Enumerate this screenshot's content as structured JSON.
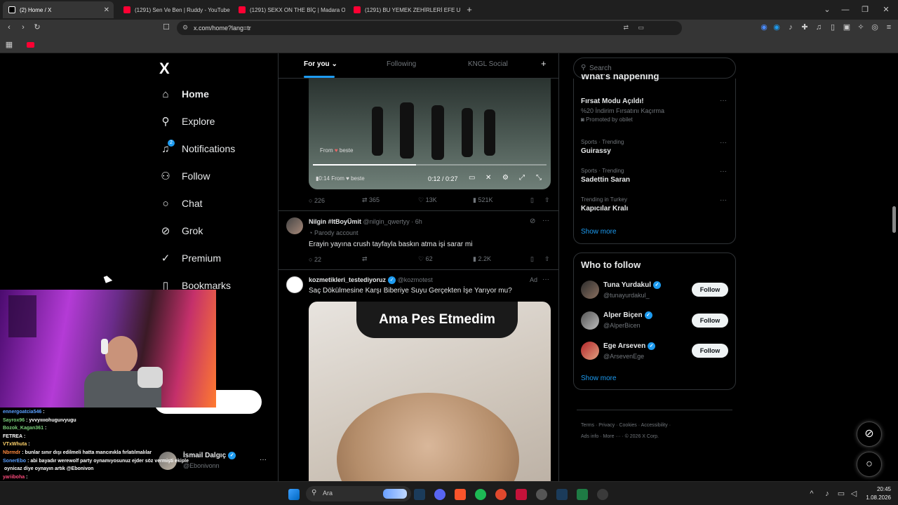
{
  "browser": {
    "tabs": [
      {
        "title": "(2) Home / X",
        "active": true
      },
      {
        "title": "(1291) Sen Ve Ben | Ruddy - YouTube"
      },
      {
        "title": "(1291) SEKX ON THE BİÇ | Madara Ol"
      },
      {
        "title": "(1291) BU YEMEK ZEHİRLERİ EFE UYG"
      }
    ],
    "new_tab": "+",
    "url": "x.com/home?lang=tr"
  },
  "sidebar": {
    "logo": "X",
    "items": [
      {
        "label": "Home",
        "icon": "home-icon"
      },
      {
        "label": "Explore",
        "icon": "search-icon"
      },
      {
        "label": "Notifications",
        "icon": "bell-icon",
        "badge": "2"
      },
      {
        "label": "Follow",
        "icon": "add-person-icon"
      },
      {
        "label": "Chat",
        "icon": "chat-icon"
      },
      {
        "label": "Grok",
        "icon": "grok-icon"
      },
      {
        "label": "Premium",
        "icon": "verified-icon"
      },
      {
        "label": "Bookmarks",
        "icon": "bookmark-icon"
      }
    ],
    "account": {
      "name": "İsmail Dalgıç",
      "handle": "@Ebonivonn",
      "more": "···"
    }
  },
  "feed": {
    "tabs": [
      "For you",
      "Following",
      "KNGL Social"
    ],
    "add_tab": "+",
    "video_post": {
      "overlay_from": "From",
      "overlay_source": "beste",
      "time_current": "0:12 / 0:27",
      "mini_label": "0:14",
      "replies": "226",
      "reposts": "365",
      "likes": "13K",
      "views": "521K"
    },
    "post2": {
      "name": "Nilgin #ItBoyÜmit",
      "handle": "@nilgin_qwertyy · 6h",
      "label": "Parody account",
      "text": "Erayin yayına crush tayfayla baskın atma işi sarar mi",
      "replies": "22",
      "likes": "62",
      "views": "2.2K"
    },
    "post3": {
      "name": "kozmetikleri_testediyoruz",
      "handle": "@kozmotest",
      "ad": "Ad",
      "text": "Saç Dökülmesine Karşı Biberiye Suyu Gerçekten İşe Yarıyor mu?",
      "caption": "Ama Pes Etmedim"
    }
  },
  "right": {
    "search_placeholder": "Search",
    "happening_title": "What's happening",
    "trends": [
      {
        "top": "",
        "title": "Fırsat Modu Açıldı!",
        "sub": "%20 İndirim Fırsatını Kaçırma",
        "promo": "Promoted by obilet"
      },
      {
        "top": "Sports · Trending",
        "title": "Guirassy"
      },
      {
        "top": "Sports · Trending",
        "title": "Sadettin Saran"
      },
      {
        "top": "Trending in Turkey",
        "title": "Kapıcılar Kralı"
      }
    ],
    "show_more": "Show more",
    "who_title": "Who to follow",
    "who": [
      {
        "name": "Tuna Yurdakul",
        "handle": "@tunayurdakul_",
        "btn": "Follow"
      },
      {
        "name": "Alper Biçen",
        "handle": "@AlperBicen",
        "btn": "Follow"
      },
      {
        "name": "Ege Arseven",
        "handle": "@ArsevenEge",
        "btn": "Follow"
      }
    ],
    "show_more2": "Show more",
    "footer": [
      "Terms",
      "Privacy",
      "Cookies",
      "Accessibility",
      "Ads info",
      "More ···",
      "© 2026 X Corp."
    ]
  },
  "chat": [
    {
      "user": "ennergoatcia546",
      "msg": ":",
      "color": "#5aa0ff"
    },
    {
      "user": "Sayrox96",
      "msg": ": yvvyııııohuguıvyugu",
      "color": "#7cd17c"
    },
    {
      "user": "Bozok_Kagan361",
      "msg": ":",
      "color": "#7cd17c"
    },
    {
      "user": "FETREA",
      "msg": ":",
      "color": "#ffffff"
    },
    {
      "user": "VTxWhuta",
      "msg": ":",
      "color": "#ffd36b"
    },
    {
      "user": "Nbrmdr",
      "msg": ": bunlar sınır dışı edilmeli hatta mancınıkla fırlatılmalılar",
      "color": "#ff8a3d"
    },
    {
      "user": "SonerEbo",
      "msg": ": abi bayadır werewolf party oynamıyosunuz ejder söz vermişti ekiple",
      "color": "#5aa0ff"
    },
    {
      "user": "",
      "msg": "oynicaz diye oynayın artık @Ebonivon",
      "color": "#ffffff"
    },
    {
      "user": "yariiboha",
      "msg": ":",
      "color": "#ff4b7d"
    }
  ],
  "taskbar": {
    "search": "Ara",
    "time": "20:45",
    "date": "1.08.2026"
  },
  "colors": {
    "accent": "#1d9bf0",
    "bg": "#000000",
    "border": "#2f3336"
  }
}
